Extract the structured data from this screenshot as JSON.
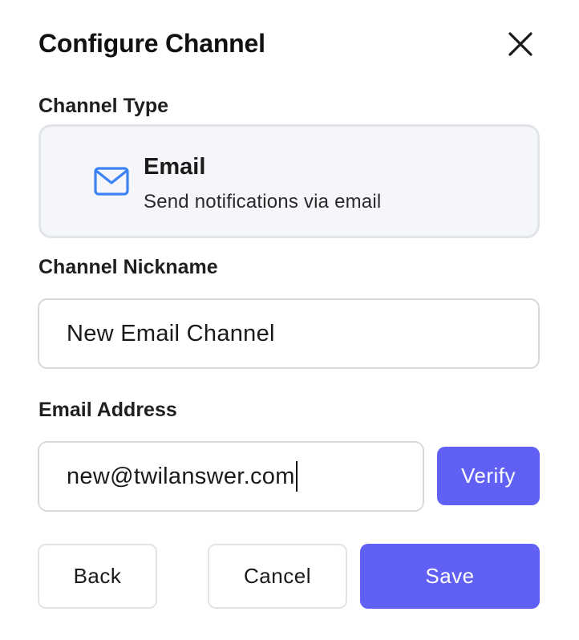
{
  "dialog": {
    "title": "Configure Channel",
    "close_icon": "close-icon"
  },
  "channel_type": {
    "label": "Channel Type",
    "selected": {
      "icon": "mail-icon",
      "name": "Email",
      "description": "Send notifications via email"
    }
  },
  "nickname": {
    "label": "Channel Nickname",
    "value": "New Email Channel"
  },
  "email": {
    "label": "Email Address",
    "value": "new@twilanswer.com",
    "verify_label": "Verify"
  },
  "footer": {
    "back_label": "Back",
    "cancel_label": "Cancel",
    "save_label": "Save"
  },
  "colors": {
    "accent": "#6060f4",
    "icon_blue": "#3b82f6",
    "card_bg": "#f4f6f9",
    "border": "#d7d9dd"
  }
}
